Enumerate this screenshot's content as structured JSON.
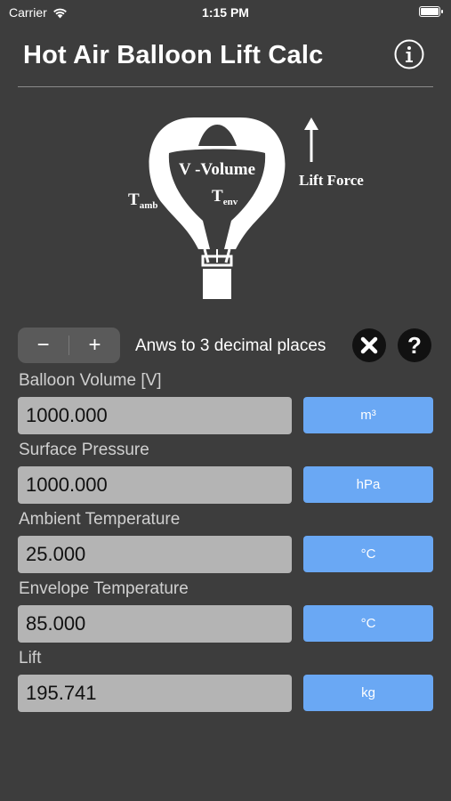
{
  "status_bar": {
    "carrier": "Carrier",
    "time": "1:15 PM"
  },
  "header": {
    "title": "Hot Air Balloon Lift Calc",
    "info_icon": "info-circle-icon"
  },
  "diagram": {
    "t_amb": "T",
    "t_amb_sub": "amb",
    "volume": "V -Volume",
    "t_env": "T",
    "t_env_sub": "env",
    "lift_force": "Lift Force"
  },
  "controls": {
    "decrement": "−",
    "increment": "+",
    "decimals_label": "Anws to 3 decimal places",
    "clear_icon": "close-circle-icon",
    "help_icon": "help-circle-icon"
  },
  "fields": [
    {
      "label": "Balloon Volume [V]",
      "value": "1000.000",
      "unit": "m³"
    },
    {
      "label": "Surface Pressure",
      "value": "1000.000",
      "unit": "hPa"
    },
    {
      "label": "Ambient Temperature",
      "value": "25.000",
      "unit": "°C"
    },
    {
      "label": "Envelope Temperature",
      "value": "85.000",
      "unit": "°C"
    },
    {
      "label": "Lift",
      "value": "195.741",
      "unit": "kg"
    }
  ],
  "colors": {
    "background": "#3d3d3d",
    "input_bg": "#b4b4b4",
    "unit_button": "#6aa8f4"
  }
}
